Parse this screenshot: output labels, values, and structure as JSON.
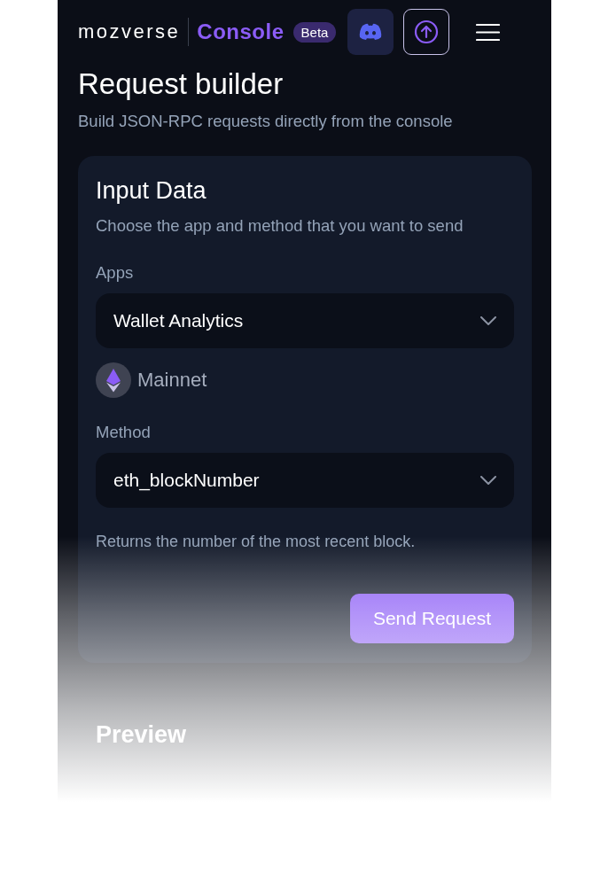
{
  "header": {
    "brand": "mozverse",
    "product": "Console",
    "badge": "Beta"
  },
  "page": {
    "title": "Request builder",
    "subtitle": "Build JSON-RPC requests directly from the console"
  },
  "input_card": {
    "title": "Input Data",
    "description": "Choose the app and method that you want to send",
    "apps": {
      "label": "Apps",
      "value": "Wallet Analytics"
    },
    "network": {
      "label": "Mainnet"
    },
    "method": {
      "label": "Method",
      "value": "eth_blockNumber",
      "hint": "Returns the number of the most recent block."
    },
    "button": "Send Request"
  },
  "preview": {
    "title": "Preview"
  }
}
